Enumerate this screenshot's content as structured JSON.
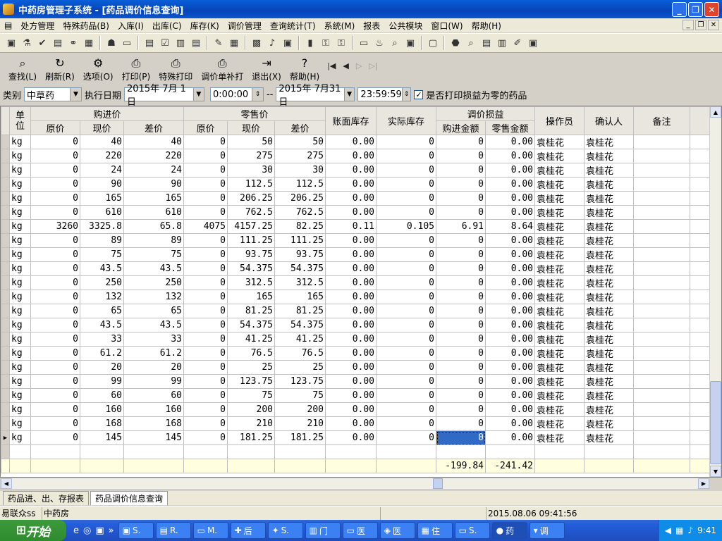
{
  "window": {
    "title": "中药房管理子系统 - [药品调价信息查询]"
  },
  "menu": [
    "处方管理",
    "特殊药品(B)",
    "入库(I)",
    "出库(C)",
    "库存(K)",
    "调价管理",
    "查询统计(T)",
    "系统(M)",
    "报表",
    "公共模块",
    "窗口(W)",
    "帮助(H)"
  ],
  "toolbar2": [
    {
      "icon": "search-icon",
      "label": "查找(L)"
    },
    {
      "icon": "refresh-icon",
      "label": "刷新(R)"
    },
    {
      "icon": "options-icon",
      "label": "选项(O)"
    },
    {
      "icon": "print-icon",
      "label": "打印(P)"
    },
    {
      "icon": "print-icon",
      "label": "特殊打印"
    },
    {
      "icon": "print-icon",
      "label": "调价单补打"
    },
    {
      "icon": "exit-icon",
      "label": "退出(X)"
    },
    {
      "icon": "help-icon",
      "label": "帮助(H)"
    }
  ],
  "filter": {
    "category_label": "类别",
    "category_value": "中草药",
    "date_label": "执行日期",
    "start_date": "2015年 7月 1日",
    "start_time": "0:00:00",
    "dash": "--",
    "end_date": "2015年 7月31日",
    "end_time": "23:59:59",
    "checkbox_label": "是否打印损益为零的药品",
    "checkbox_checked": true
  },
  "headers": {
    "unit": "单位",
    "purchase": "购进价",
    "retail": "零售价",
    "orig": "原价",
    "now": "现价",
    "diff": "差价",
    "book_stock": "账面库存",
    "actual_stock": "实际库存",
    "profit": "调价损益",
    "purchase_amt": "购进金额",
    "retail_amt": "零售金额",
    "operator": "操作员",
    "confirmer": "确认人",
    "remark": "备注"
  },
  "rows": [
    [
      "kg",
      "0",
      "40",
      "40",
      "0",
      "50",
      "50",
      "0.00",
      "0",
      "0",
      "0.00",
      "袁桂花",
      "袁桂花",
      ""
    ],
    [
      "kg",
      "0",
      "220",
      "220",
      "0",
      "275",
      "275",
      "0.00",
      "0",
      "0",
      "0.00",
      "袁桂花",
      "袁桂花",
      ""
    ],
    [
      "kg",
      "0",
      "24",
      "24",
      "0",
      "30",
      "30",
      "0.00",
      "0",
      "0",
      "0.00",
      "袁桂花",
      "袁桂花",
      ""
    ],
    [
      "kg",
      "0",
      "90",
      "90",
      "0",
      "112.5",
      "112.5",
      "0.00",
      "0",
      "0",
      "0.00",
      "袁桂花",
      "袁桂花",
      ""
    ],
    [
      "kg",
      "0",
      "165",
      "165",
      "0",
      "206.25",
      "206.25",
      "0.00",
      "0",
      "0",
      "0.00",
      "袁桂花",
      "袁桂花",
      ""
    ],
    [
      "kg",
      "0",
      "610",
      "610",
      "0",
      "762.5",
      "762.5",
      "0.00",
      "0",
      "0",
      "0.00",
      "袁桂花",
      "袁桂花",
      ""
    ],
    [
      "kg",
      "3260",
      "3325.8",
      "65.8",
      "4075",
      "4157.25",
      "82.25",
      "0.11",
      "0.105",
      "6.91",
      "8.64",
      "袁桂花",
      "袁桂花",
      ""
    ],
    [
      "kg",
      "0",
      "89",
      "89",
      "0",
      "111.25",
      "111.25",
      "0.00",
      "0",
      "0",
      "0.00",
      "袁桂花",
      "袁桂花",
      ""
    ],
    [
      "kg",
      "0",
      "75",
      "75",
      "0",
      "93.75",
      "93.75",
      "0.00",
      "0",
      "0",
      "0.00",
      "袁桂花",
      "袁桂花",
      ""
    ],
    [
      "kg",
      "0",
      "43.5",
      "43.5",
      "0",
      "54.375",
      "54.375",
      "0.00",
      "0",
      "0",
      "0.00",
      "袁桂花",
      "袁桂花",
      ""
    ],
    [
      "kg",
      "0",
      "250",
      "250",
      "0",
      "312.5",
      "312.5",
      "0.00",
      "0",
      "0",
      "0.00",
      "袁桂花",
      "袁桂花",
      ""
    ],
    [
      "kg",
      "0",
      "132",
      "132",
      "0",
      "165",
      "165",
      "0.00",
      "0",
      "0",
      "0.00",
      "袁桂花",
      "袁桂花",
      ""
    ],
    [
      "kg",
      "0",
      "65",
      "65",
      "0",
      "81.25",
      "81.25",
      "0.00",
      "0",
      "0",
      "0.00",
      "袁桂花",
      "袁桂花",
      ""
    ],
    [
      "kg",
      "0",
      "43.5",
      "43.5",
      "0",
      "54.375",
      "54.375",
      "0.00",
      "0",
      "0",
      "0.00",
      "袁桂花",
      "袁桂花",
      ""
    ],
    [
      "kg",
      "0",
      "33",
      "33",
      "0",
      "41.25",
      "41.25",
      "0.00",
      "0",
      "0",
      "0.00",
      "袁桂花",
      "袁桂花",
      ""
    ],
    [
      "kg",
      "0",
      "61.2",
      "61.2",
      "0",
      "76.5",
      "76.5",
      "0.00",
      "0",
      "0",
      "0.00",
      "袁桂花",
      "袁桂花",
      ""
    ],
    [
      "kg",
      "0",
      "20",
      "20",
      "0",
      "25",
      "25",
      "0.00",
      "0",
      "0",
      "0.00",
      "袁桂花",
      "袁桂花",
      ""
    ],
    [
      "kg",
      "0",
      "99",
      "99",
      "0",
      "123.75",
      "123.75",
      "0.00",
      "0",
      "0",
      "0.00",
      "袁桂花",
      "袁桂花",
      ""
    ],
    [
      "kg",
      "0",
      "60",
      "60",
      "0",
      "75",
      "75",
      "0.00",
      "0",
      "0",
      "0.00",
      "袁桂花",
      "袁桂花",
      ""
    ],
    [
      "kg",
      "0",
      "160",
      "160",
      "0",
      "200",
      "200",
      "0.00",
      "0",
      "0",
      "0.00",
      "袁桂花",
      "袁桂花",
      ""
    ],
    [
      "kg",
      "0",
      "168",
      "168",
      "0",
      "210",
      "210",
      "0.00",
      "0",
      "0",
      "0.00",
      "袁桂花",
      "袁桂花",
      ""
    ],
    [
      "kg",
      "0",
      "145",
      "145",
      "0",
      "181.25",
      "181.25",
      "0.00",
      "0",
      "0",
      "0.00",
      "袁桂花",
      "袁桂花",
      ""
    ]
  ],
  "totals": {
    "purchase_amt": "-199.84",
    "retail_amt": "-241.42"
  },
  "tabs": [
    "药品进、出、存报表",
    "药品调价信息查询"
  ],
  "status": {
    "user": "易联众ss",
    "dept": "中药房",
    "datetime": "2015.08.06 09:41:56"
  },
  "taskbar": {
    "start": "开始",
    "tasks": [
      "S.",
      "R.",
      "M.",
      "后",
      "S.",
      "门",
      "医",
      "医",
      "住",
      "S.",
      "药",
      "调"
    ],
    "clock": "9:41"
  }
}
